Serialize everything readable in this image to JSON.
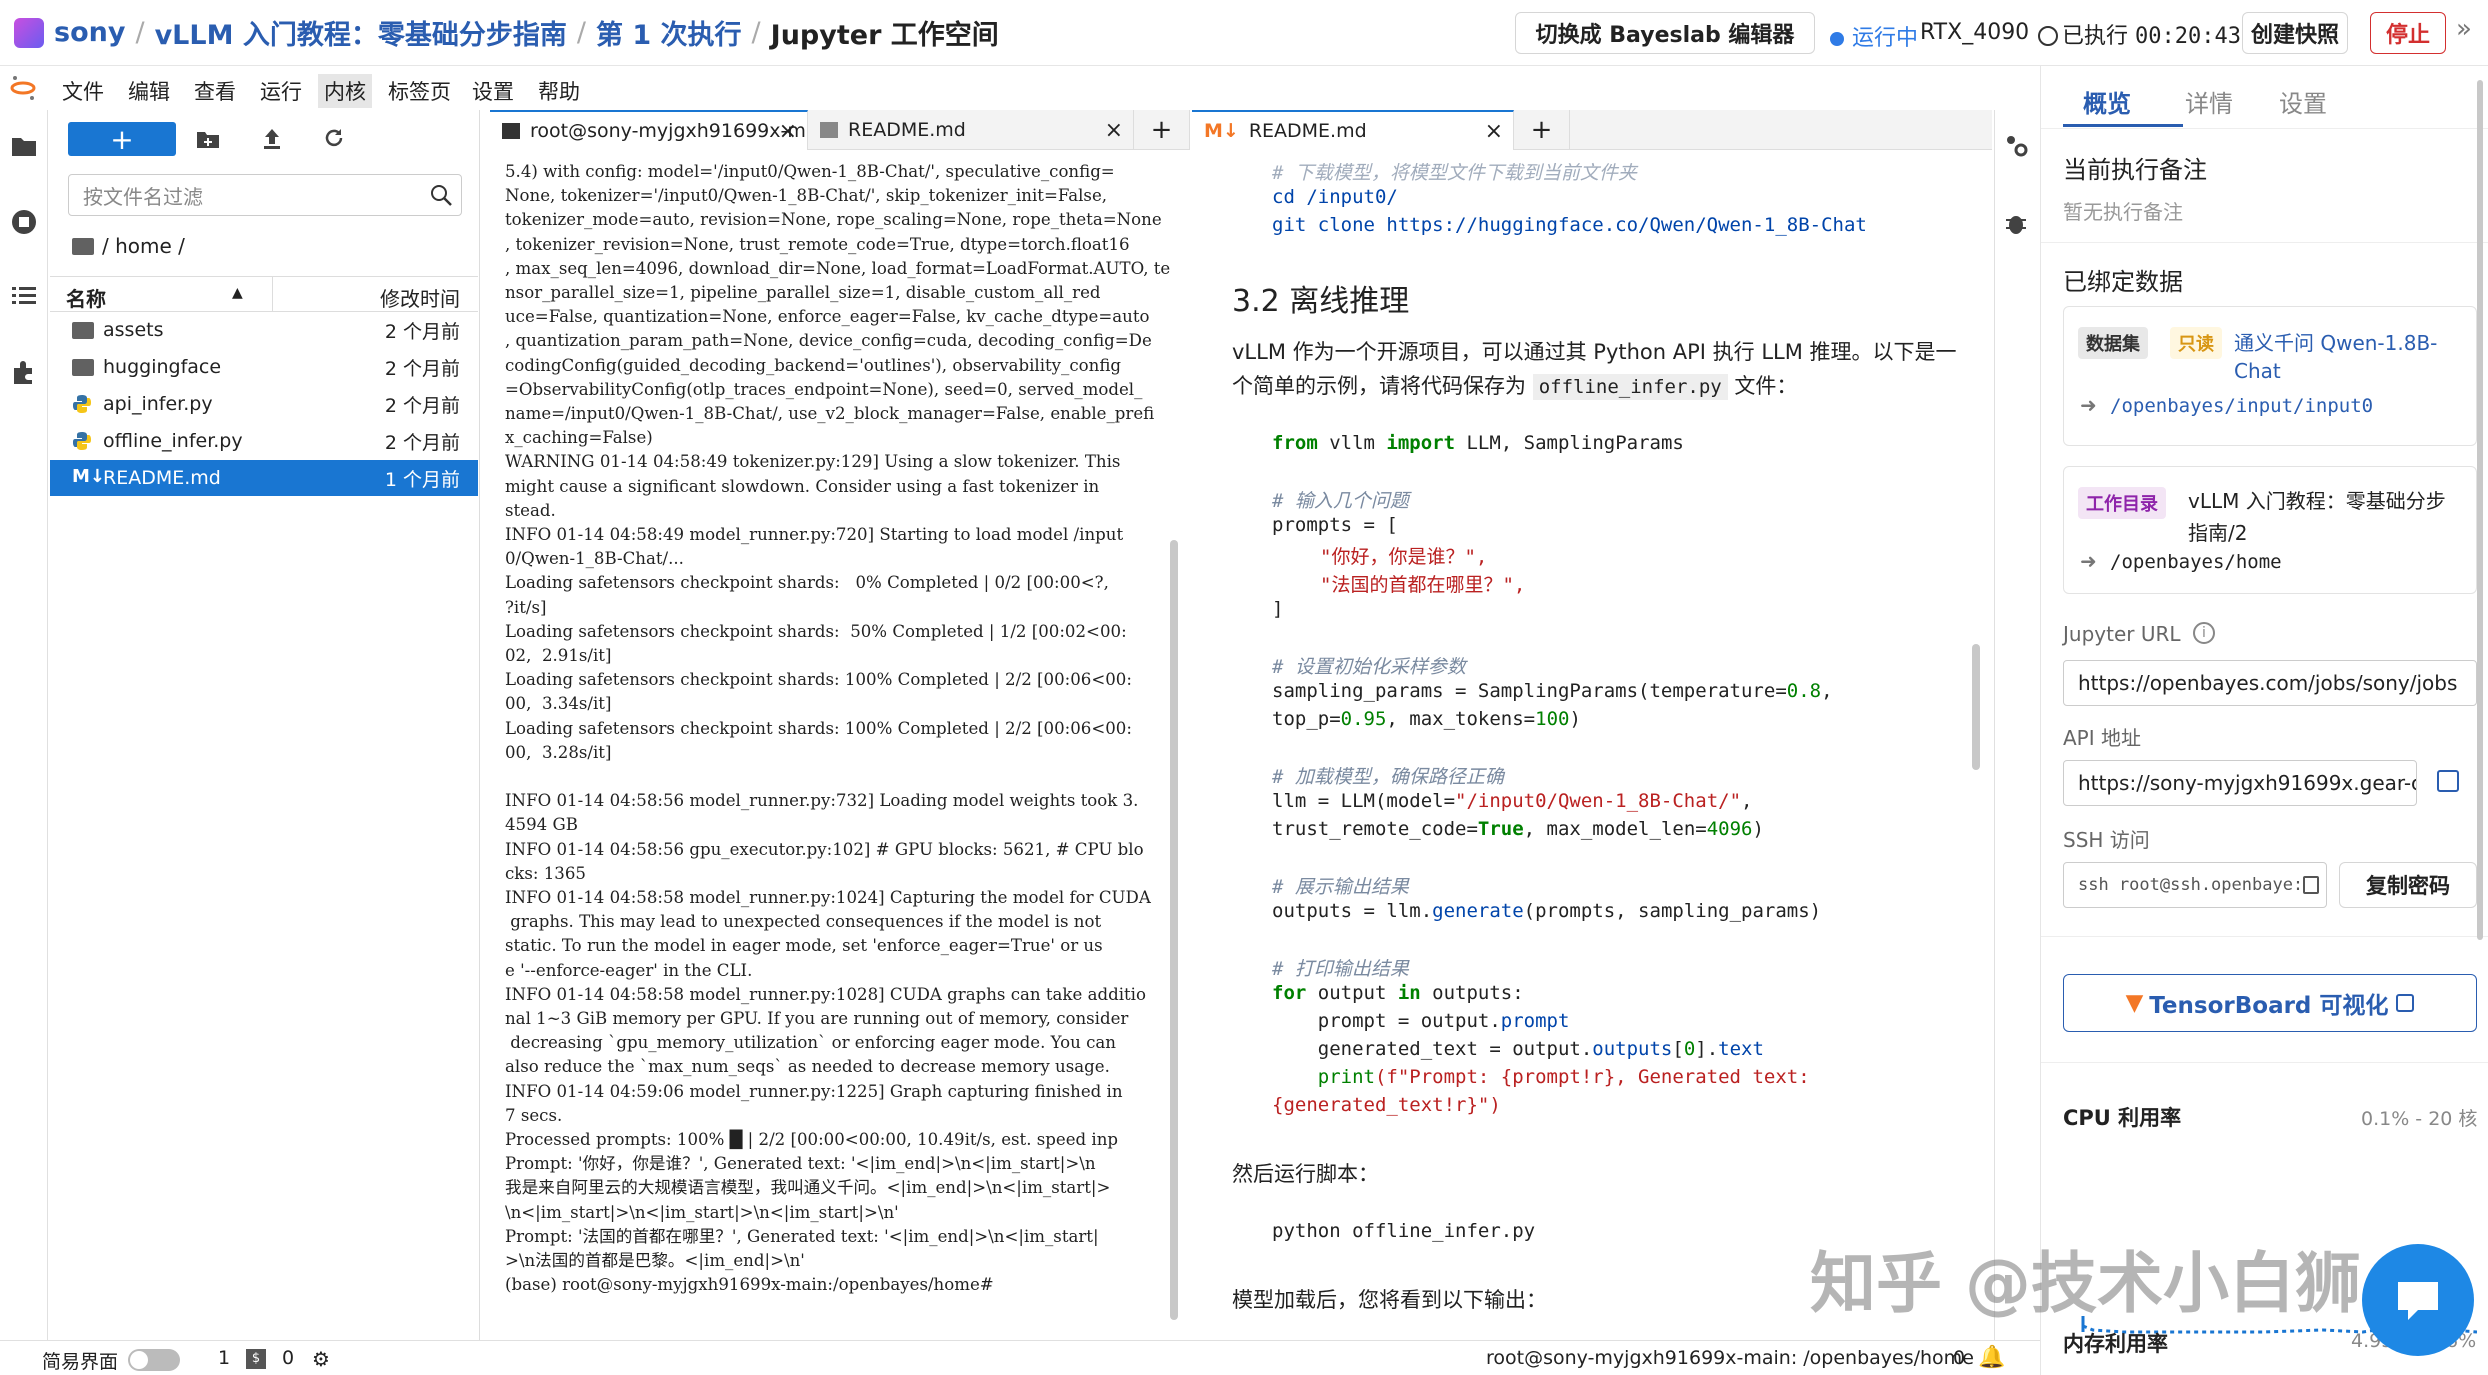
{
  "header": {
    "user": "sony",
    "breadcrumb_1": "vLLM 入门教程：零基础分步指南",
    "breadcrumb_2": "第 1 次执行",
    "breadcrumb_3": "Jupyter 工作空间",
    "switch_editor": "切换成 Bayeslab 编辑器",
    "status": "运行中",
    "gpu": "RTX_4090",
    "runtime_label": "已执行",
    "runtime": "00:20:43",
    "snapshot": "创建快照",
    "stop": "停止"
  },
  "menu": [
    "文件",
    "编辑",
    "查看",
    "运行",
    "内核",
    "标签页",
    "设置",
    "帮助"
  ],
  "filebrowser": {
    "filter_placeholder": "按文件名过滤",
    "path": "/ home /",
    "col_name": "名称",
    "col_modified": "修改时间",
    "files": [
      {
        "name": "assets",
        "modified": "2 个月前",
        "icon": "folder-icon"
      },
      {
        "name": "huggingface",
        "modified": "2 个月前",
        "icon": "folder-icon"
      },
      {
        "name": "api_infer.py",
        "modified": "2 个月前",
        "icon": "python-icon"
      },
      {
        "name": "offline_infer.py",
        "modified": "2 个月前",
        "icon": "python-icon"
      },
      {
        "name": "README.md",
        "modified": "1 个月前",
        "icon": "markdown-icon"
      }
    ]
  },
  "tabs_left": [
    "root@sony-myjgxh91699x-m",
    "README.md"
  ],
  "tabs_right": [
    "README.md"
  ],
  "terminal": [
    "5.4) with config: model='/input0/Qwen-1_8B-Chat/', speculative_config=",
    "None, tokenizer='/input0/Qwen-1_8B-Chat/', skip_tokenizer_init=False,",
    "tokenizer_mode=auto, revision=None, rope_scaling=None, rope_theta=None",
    ", tokenizer_revision=None, trust_remote_code=True, dtype=torch.float16",
    ", max_seq_len=4096, download_dir=None, load_format=LoadFormat.AUTO, te",
    "nsor_parallel_size=1, pipeline_parallel_size=1, disable_custom_all_red",
    "uce=False, quantization=None, enforce_eager=False, kv_cache_dtype=auto",
    ", quantization_param_path=None, device_config=cuda, decoding_config=De",
    "codingConfig(guided_decoding_backend='outlines'), observability_config",
    "=ObservabilityConfig(otlp_traces_endpoint=None), seed=0, served_model_",
    "name=/input0/Qwen-1_8B-Chat/, use_v2_block_manager=False, enable_prefi",
    "x_caching=False)",
    "WARNING 01-14 04:58:49 tokenizer.py:129] Using a slow tokenizer. This",
    "might cause a significant slowdown. Consider using a fast tokenizer in",
    "stead.",
    "INFO 01-14 04:58:49 model_runner.py:720] Starting to load model /input",
    "0/Qwen-1_8B-Chat/...",
    "Loading safetensors checkpoint shards:   0% Completed | 0/2 [00:00<?,",
    "?it/s]",
    "Loading safetensors checkpoint shards:  50% Completed | 1/2 [00:02<00:",
    "02,  2.91s/it]",
    "Loading safetensors checkpoint shards: 100% Completed | 2/2 [00:06<00:",
    "00,  3.34s/it]",
    "Loading safetensors checkpoint shards: 100% Completed | 2/2 [00:06<00:",
    "00,  3.28s/it]",
    "",
    "INFO 01-14 04:58:56 model_runner.py:732] Loading model weights took 3.",
    "4594 GB",
    "INFO 01-14 04:58:56 gpu_executor.py:102] # GPU blocks: 5621, # CPU blo",
    "cks: 1365",
    "INFO 01-14 04:58:58 model_runner.py:1024] Capturing the model for CUDA",
    " graphs. This may lead to unexpected consequences if the model is not",
    "static. To run the model in eager mode, set 'enforce_eager=True' or us",
    "e '--enforce-eager' in the CLI.",
    "INFO 01-14 04:58:58 model_runner.py:1028] CUDA graphs can take additio",
    "nal 1~3 GiB memory per GPU. If you are running out of memory, consider",
    " decreasing `gpu_memory_utilization` or enforcing eager mode. You can",
    "also reduce the `max_num_seqs` as needed to decrease memory usage.",
    "INFO 01-14 04:59:06 model_runner.py:1225] Graph capturing finished in",
    "7 secs.",
    "Processed prompts: 100% █ | 2/2 [00:00<00:00, 10.49it/s, est. speed inp",
    "Prompt: '你好，你是谁？', Generated text: '<|im_end|>\\n<|im_start|>\\n",
    "我是来自阿里云的大规模语言模型，我叫通义千问。<|im_end|>\\n<|im_start|>",
    "\\n<|im_start|>\\n<|im_start|>\\n<|im_start|>\\n'",
    "Prompt: '法国的首都在哪里？', Generated text: '<|im_end|>\\n<|im_start|",
    ">\\n法国的首都是巴黎。<|im_end|>\\n'",
    "(base) root@sony-myjgxh91699x-main:/openbayes/home#"
  ],
  "readme": {
    "cut_comment": "# 下载模型，将模型文件下载到当前文件夹",
    "cmd1": "cd /input0/",
    "cmd2": "git clone https://huggingface.co/Qwen/Qwen-1_8B-Chat",
    "h3": "3.2 离线推理",
    "para1a": "vLLM 作为一个开源项目，可以通过其 Python API 执行 LLM 推理。以下是一",
    "para1b": "个简单的示例，请将代码保存为",
    "para1_code": "offline_infer.py",
    "para1c": "文件：",
    "code_import_from": "from",
    "code_import_mod": " vllm ",
    "code_import_kw": "import",
    "code_import_names": " LLM, SamplingParams",
    "c1": "# 输入几个问题",
    "prompts_open": "prompts = [",
    "p1": "\"你好，你是谁？\",",
    "p2": "\"法国的首都在哪里？\",",
    "prompts_close": "]",
    "c2": "# 设置初始化采样参数",
    "sp_a": "sampling_params = SamplingParams(temperature=",
    "sp_b": "0.8",
    "sp_c": ",",
    "sp2_a": "top_p=",
    "sp2_b": "0.95",
    "sp2_c": ", max_tokens=",
    "sp2_d": "100",
    "sp2_e": ")",
    "c3": "# 加载模型，确保路径正确",
    "llm_a": "llm = LLM(model=",
    "llm_b": "\"/input0/Qwen-1_8B-Chat/\"",
    "llm_c": ",",
    "llm2_a": "trust_remote_code=",
    "llm2_b": "True",
    "llm2_c": ", max_model_len=",
    "llm2_d": "4096",
    "llm2_e": ")",
    "c4": "# 展示输出结果",
    "out_a": "outputs = llm.",
    "out_b": "generate",
    "out_c": "(prompts, sampling_params)",
    "c5": "# 打印输出结果",
    "for_a": "for",
    "for_b": " output ",
    "for_c": "in",
    "for_d": " outputs:",
    "l1_a": "    prompt = output.",
    "l1_b": "prompt",
    "l2_a": "    generated_text = output.",
    "l2_b": "outputs",
    "l2_c": "[",
    "l2_d": "0",
    "l2_e": "].",
    "l2_f": "text",
    "l3_a": "    print",
    "l3_b": "(f\"Prompt: {prompt!r}, Generated text:",
    "l4": "{generated_text!r}\")",
    "para2": "然后运行脚本：",
    "cmd3": "python offline_infer.py",
    "para3": "模型加载后，您将看到以下输出："
  },
  "rightpanel": {
    "tabs": [
      "概览",
      "详情",
      "设置"
    ],
    "note_title": "当前执行备注",
    "note_empty": "暂无执行备注",
    "bound_title": "已绑定数据",
    "ds_tag": "数据集",
    "ro_tag": "只读",
    "ds_name_1": "通义千问 Qwen-1.8B-",
    "ds_name_2": "Chat",
    "ds_path": "/openbayes/input/input0",
    "wd_tag": "工作目录",
    "wd_name_1": "vLLM 入门教程：零基础分步",
    "wd_name_2": "指南/2",
    "wd_path": "/openbayes/home",
    "jupyter_label": "Jupyter URL",
    "jupyter_url": "https://openbayes.com/jobs/sony/jobs",
    "api_label": "API 地址",
    "api_url": "https://sony-myjgxh91699x.gear-c",
    "ssh_label": "SSH 访问",
    "ssh_cmd": "ssh root@ssh.openbaye:",
    "copy_pwd": "复制密码",
    "tensorboard": "TensorBoard 可视化",
    "cpu_label": "CPU 利用率",
    "cpu_value": "0.1% - 20 核",
    "mem_label": "内存利用率",
    "mem_value": "4.93 GB",
    "mem_pct": "6%"
  },
  "statusbar": {
    "simple_mode": "简易界面",
    "n1": "1",
    "n2": "0",
    "path": "root@sony-myjgxh91699x-main: /openbayes/home",
    "n3": "0"
  },
  "watermark": "知乎 @技术小白狮",
  "colors": {
    "accent": "#1976d2",
    "brand": "#2a5db0",
    "stop": "#d32f2f"
  }
}
